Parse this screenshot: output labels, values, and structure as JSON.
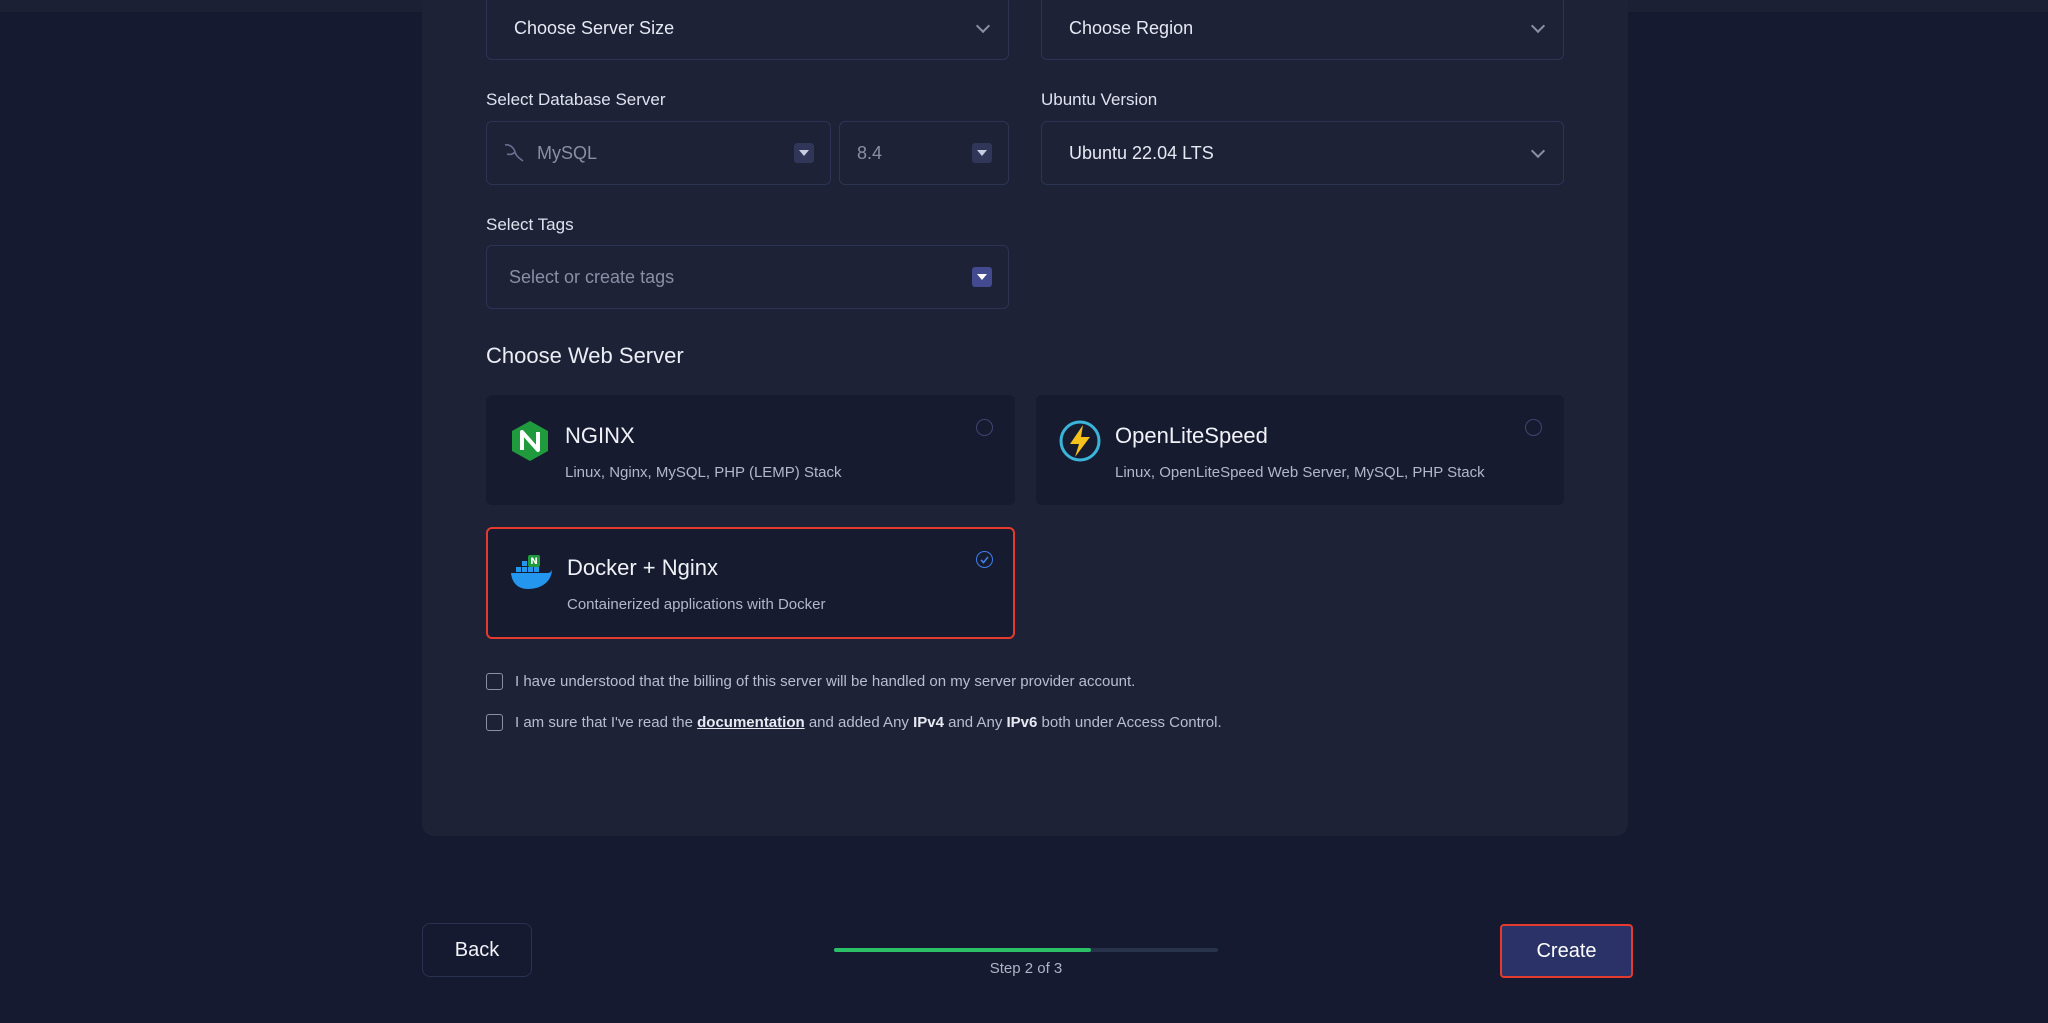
{
  "form": {
    "server_size": {
      "value": "Choose Server Size"
    },
    "region": {
      "value": "Choose Region"
    },
    "database": {
      "label": "Select Database Server",
      "engine": "MySQL",
      "version": "8.4"
    },
    "ubuntu": {
      "label": "Ubuntu Version",
      "value": "Ubuntu 22.04 LTS"
    },
    "tags": {
      "label": "Select Tags",
      "placeholder": "Select or create tags"
    }
  },
  "web_server": {
    "title": "Choose Web Server",
    "options": [
      {
        "name": "NGINX",
        "desc": "Linux, Nginx, MySQL, PHP (LEMP) Stack",
        "icon": "nginx-logo-icon",
        "selected": false
      },
      {
        "name": "OpenLiteSpeed",
        "desc": "Linux, OpenLiteSpeed Web Server, MySQL, PHP Stack",
        "icon": "openlitespeed-logo-icon",
        "selected": false
      },
      {
        "name": "Docker + Nginx",
        "desc": "Containerized applications with Docker",
        "icon": "docker-logo-icon",
        "selected": true
      }
    ]
  },
  "agreements": {
    "billing": "I have understood that the billing of this server will be handled on my server provider account.",
    "access": {
      "pre": "I am sure that I've read the",
      "link": "documentation",
      "mid1": "and added Any",
      "ipv4": "IPv4",
      "mid2": "and Any",
      "ipv6": "IPv6",
      "post": "both under Access Control."
    }
  },
  "footer": {
    "back_label": "Back",
    "create_label": "Create",
    "step_text": "Step 2 of 3",
    "progress": 0.67
  },
  "colors": {
    "accent_green": "#2bc067",
    "highlight_red": "#e53a2e",
    "radio_blue": "#3f7fe8"
  }
}
